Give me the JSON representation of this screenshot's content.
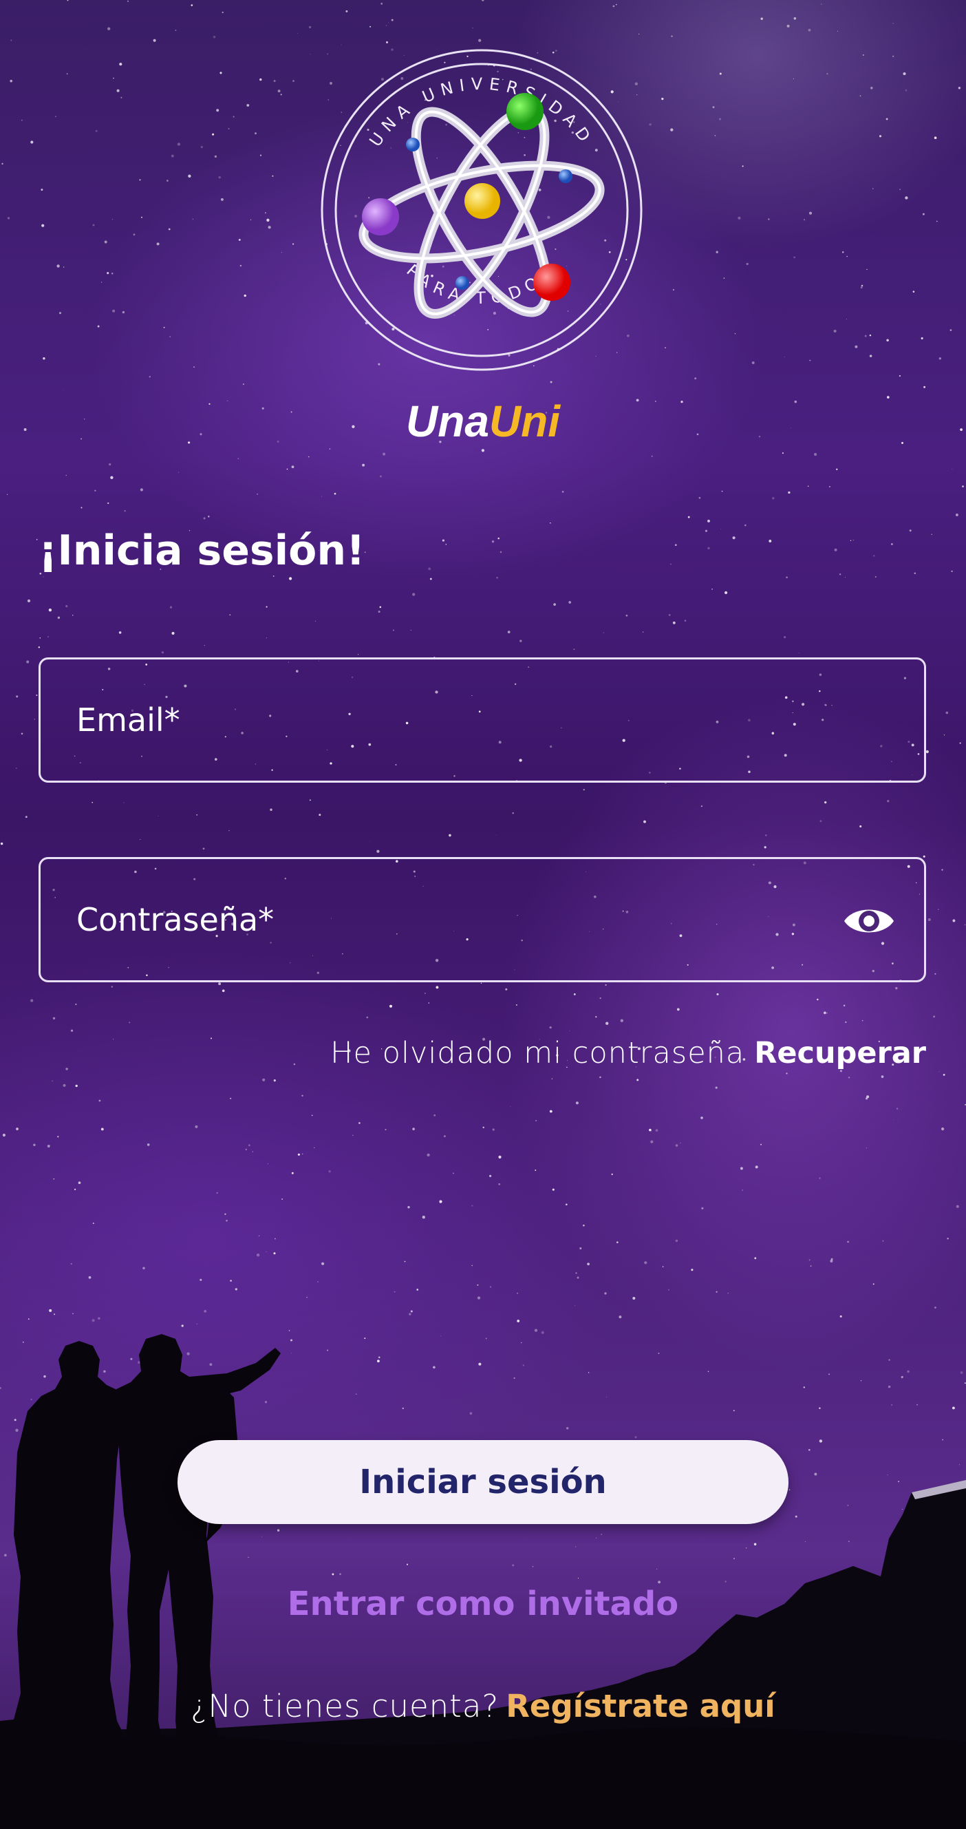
{
  "brand": {
    "name_part1": "Una",
    "name_part2": "Uni",
    "logo_top_text": "UNA UNIVERSIDAD",
    "logo_bottom_text": "PARA TODOS",
    "accent_color": "#f7b825"
  },
  "login": {
    "heading": "¡Inicia sesión!",
    "email_placeholder": "Email*",
    "password_placeholder": "Contraseña*",
    "password_toggle_icon": "eye-icon",
    "forgot_text": "He olvidado mi contraseña",
    "forgot_link": "Recuperar",
    "submit_label": "Iniciar sesión",
    "guest_label": "Entrar como invitado",
    "signup_text": "¿No tienes cuenta?",
    "signup_link": "Regístrate aquí"
  },
  "colors": {
    "button_bg": "#f3eef8",
    "button_text": "#23256b",
    "guest_text": "#b06de8",
    "signup_link": "#f0b461"
  }
}
